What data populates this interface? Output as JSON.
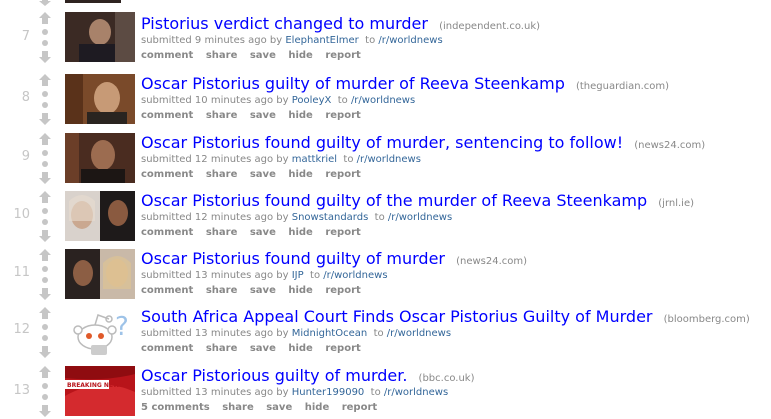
{
  "posts": [
    {
      "rank": "7",
      "title": "Pistorius verdict changed to murder",
      "domain": "(independent.co.uk)",
      "submitted": "submitted 9 minutes ago by",
      "author": "ElephantElmer",
      "to": "to",
      "subreddit": "/r/worldnews",
      "comments": "comment",
      "share": "share",
      "save": "save",
      "hide": "hide",
      "report": "report",
      "thumb_icon": "photo-courtroom-thumbnail"
    },
    {
      "rank": "8",
      "title": "Oscar Pistorius guilty of murder of Reeva Steenkamp",
      "domain": "(theguardian.com)",
      "submitted": "submitted 10 minutes ago by",
      "author": "PooleyX",
      "to": "to",
      "subreddit": "/r/worldnews",
      "comments": "comment",
      "share": "share",
      "save": "save",
      "hide": "hide",
      "report": "report",
      "thumb_icon": "photo-portrait-thumbnail"
    },
    {
      "rank": "9",
      "title": "Oscar Pistorius found guilty of murder, sentencing to follow!",
      "domain": "(news24.com)",
      "submitted": "submitted 12 minutes ago by",
      "author": "mattkriel",
      "to": "to",
      "subreddit": "/r/worldnews",
      "comments": "comment",
      "share": "share",
      "save": "save",
      "hide": "hide",
      "report": "report",
      "thumb_icon": "photo-courtroom-thumbnail"
    },
    {
      "rank": "10",
      "title": "Oscar Pistorius found guilty of the murder of Reeva Steenkamp",
      "domain": "(jrnl.ie)",
      "submitted": "submitted 12 minutes ago by",
      "author": "Snowstandards",
      "to": "to",
      "subreddit": "/r/worldnews",
      "comments": "comment",
      "share": "share",
      "save": "save",
      "hide": "hide",
      "report": "report",
      "thumb_icon": "photo-split-portrait-thumbnail"
    },
    {
      "rank": "11",
      "title": "Oscar Pistorius found guilty of murder",
      "domain": "(news24.com)",
      "submitted": "submitted 13 minutes ago by",
      "author": "IJP",
      "to": "to",
      "subreddit": "/r/worldnews",
      "comments": "comment",
      "share": "share",
      "save": "save",
      "hide": "hide",
      "report": "report",
      "thumb_icon": "photo-split-portrait-thumbnail"
    },
    {
      "rank": "12",
      "title": "South Africa Appeal Court Finds Oscar Pistorius Guilty of Murder",
      "domain": "(bloomberg.com)",
      "submitted": "submitted 13 minutes ago by",
      "author": "MidnightOcean",
      "to": "to",
      "subreddit": "/r/worldnews",
      "comments": "comment",
      "share": "share",
      "save": "save",
      "hide": "hide",
      "report": "report",
      "thumb_icon": "reddit-alien-default-thumbnail"
    },
    {
      "rank": "13",
      "title": "Oscar Pistorious guilty of murder.",
      "domain": "(bbc.co.uk)",
      "submitted": "submitted 13 minutes ago by",
      "author": "Hunter199090",
      "to": "to",
      "subreddit": "/r/worldnews",
      "comments": "5 comments",
      "share": "share",
      "save": "save",
      "hide": "hide",
      "report": "report",
      "thumb_icon": "breaking-news-thumbnail",
      "thumb_text": "BREAKING NEWS"
    }
  ],
  "colors": {
    "title_link": "#0000ff",
    "author_link": "#336699",
    "meta_text": "#888888",
    "vote_arrow": "#c6c6c6"
  }
}
